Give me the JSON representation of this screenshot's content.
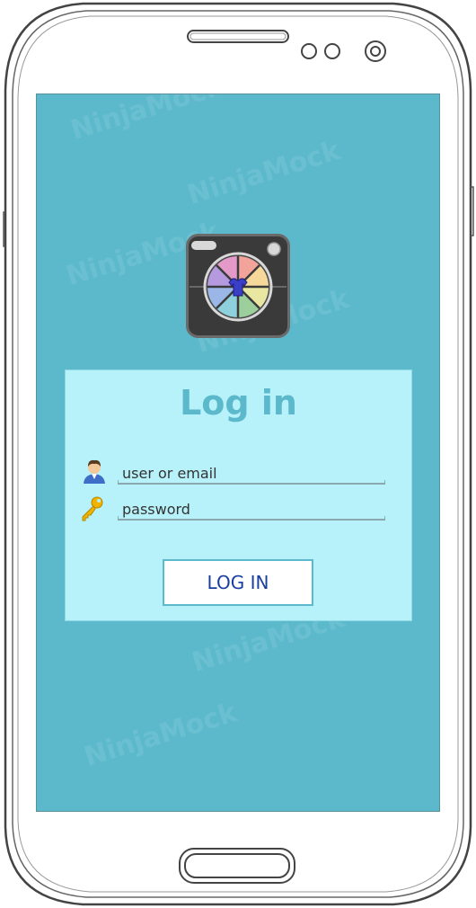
{
  "login": {
    "title": "Log in",
    "username_placeholder": "user or email",
    "password_placeholder": "password",
    "button_label": "LOG IN"
  },
  "watermark": "NinjaMock",
  "colors": {
    "screen": "#5cb9cc",
    "card": "#b7f1fa",
    "title": "#5cb9cc",
    "button_text": "#1a3fa0"
  },
  "icons": {
    "app_logo": "camera-aperture-shirt-icon",
    "user_field": "user-avatar-icon",
    "password_field": "key-icon"
  }
}
